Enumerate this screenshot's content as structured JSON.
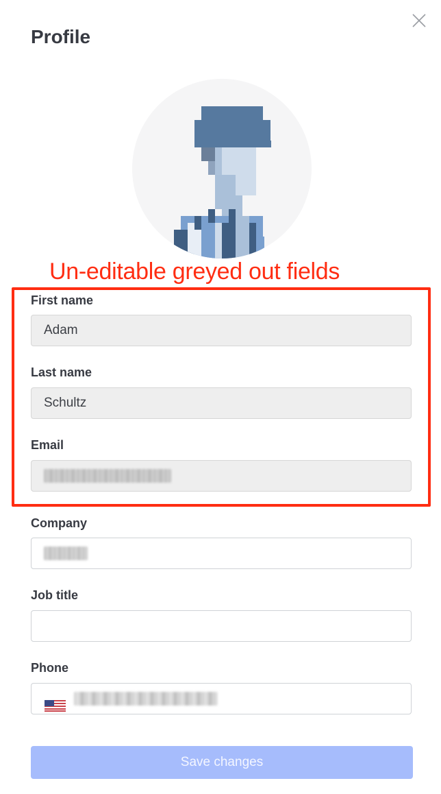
{
  "header": {
    "title": "Profile"
  },
  "annotation": {
    "text": "Un-editable greyed out fields",
    "color": "#ff2d12"
  },
  "form": {
    "first_name": {
      "label": "First name",
      "value": "Adam",
      "editable": false
    },
    "last_name": {
      "label": "Last name",
      "value": "Schultz",
      "editable": false
    },
    "email": {
      "label": "Email",
      "editable": false
    },
    "company": {
      "label": "Company"
    },
    "job_title": {
      "label": "Job title",
      "value": ""
    },
    "phone": {
      "label": "Phone",
      "country_flag": "us-flag-icon"
    }
  },
  "actions": {
    "save_label": "Save changes"
  },
  "icons": {
    "close": "close-icon"
  },
  "colors": {
    "disabled_field_bg": "#eeeeee",
    "primary_button_disabled": "#a6bcfc",
    "avatar_bg": "#f5f5f6"
  }
}
